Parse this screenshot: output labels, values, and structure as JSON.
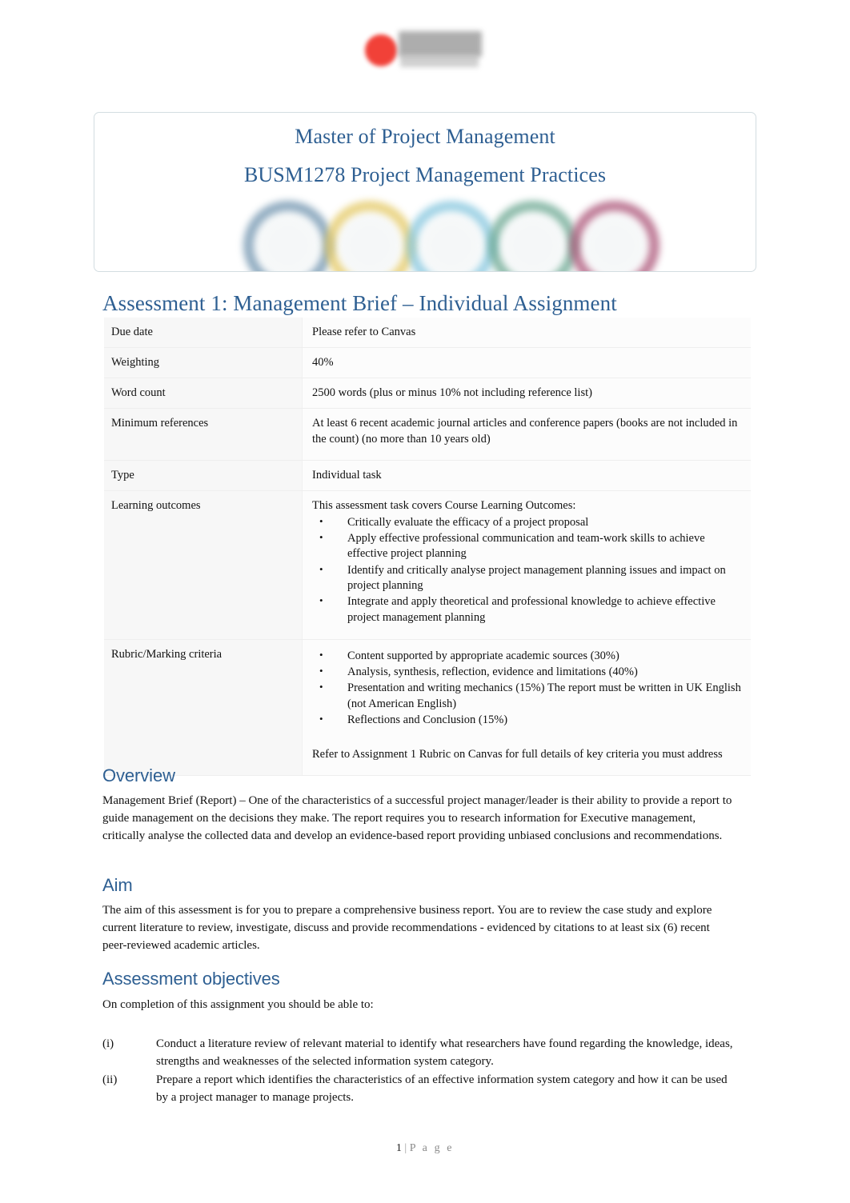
{
  "logo": {
    "name": "RMIT University",
    "dot_color": "#f0332a",
    "word_color": "#8e8e8e"
  },
  "banner": {
    "title": "Master of Project Management",
    "subtitle": "BUSM1278 Project Management Practices",
    "title_color": "#2e5f92",
    "border_color": "#d3dde1",
    "rings": [
      {
        "name": "ring-blue-grey",
        "color": "#6a8fab"
      },
      {
        "name": "ring-gold",
        "color": "#e3c65c"
      },
      {
        "name": "ring-light-blue",
        "color": "#7fc3dc"
      },
      {
        "name": "ring-green",
        "color": "#64a38c"
      },
      {
        "name": "ring-magenta",
        "color": "#a84d72"
      }
    ]
  },
  "assessment": {
    "title": "Assessment 1: Management Brief – Individual Assignment"
  },
  "table": {
    "rows": [
      {
        "label": "Due date",
        "value": "Please refer to Canvas"
      },
      {
        "label": "Weighting",
        "value": "40%"
      },
      {
        "label": "Word count",
        "value": "2500 words (plus or minus 10% not including reference list)"
      },
      {
        "label": "Minimum references",
        "value": "At least 6   recent   academic journal articles and conference papers (books are not included in the count) (no more than 10 years old)"
      },
      {
        "label": "Type",
        "value": "Individual task"
      }
    ],
    "learning_outcomes": {
      "label": "Learning outcomes",
      "intro": "This assessment task covers Course Learning Outcomes:",
      "bullets": [
        "Critically evaluate the efficacy of a project proposal",
        "Apply effective professional communication and team-work skills to achieve effective project planning",
        "Identify and critically analyse project management planning issues and impact on project planning",
        "Integrate and apply theoretical and professional knowledge to achieve effective project management planning"
      ]
    },
    "rubric": {
      "label": "Rubric/Marking criteria",
      "bullets": [
        "Content supported by appropriate academic sources (30%)",
        "Analysis, synthesis, reflection, evidence and limitations (40%)",
        "Presentation and writing mechanics (15%) The report must be written in UK English (not American English)",
        "Reflections and Conclusion (15%)"
      ],
      "note": "Refer to Assignment 1 Rubric on Canvas for full details of key criteria you must address"
    }
  },
  "overview": {
    "heading": "Overview",
    "paragraph": "Management Brief (Report)      – One of the   characteristics of a successful      project manager/leader is their ability to provide a report to guide management on the decisions they make.            The report requires you to research information for Executive management, critically analyse the collected data and develop an evidence-based report providing unbiased conclusions and recommendations."
  },
  "aim": {
    "heading": "Aim",
    "paragraph": "The aim of this assessment is for you to prepare a comprehensive business report. You are to review the case study and explore current literature to review, investigate, discuss and provide recommendations - evidenced by citations to at least six (6)     recent   peer-reviewed academic articles."
  },
  "objectives": {
    "heading": "Assessment objectives",
    "intro": "On completion of this assignment you should be able to:",
    "items": [
      {
        "marker": "(i)",
        "text": "Conduct a literature review of relevant material to identify what researchers have found regarding the knowledge, ideas, strengths and weaknesses of the selected information system category."
      },
      {
        "marker": "(ii)",
        "text": "Prepare a report which identifies the characteristics of an effective information system category and how it can be used by a project manager to manage projects."
      }
    ]
  },
  "footer": {
    "page_number": "1",
    "separator": "|",
    "page_word": "P a g e"
  }
}
